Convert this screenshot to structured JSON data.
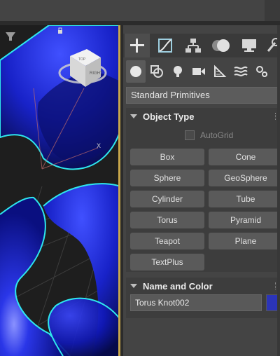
{
  "panel": {
    "dropdown_value": "Standard Primitives",
    "object_type": {
      "title": "Object Type",
      "autogrid_label": "AutoGrid",
      "buttons": [
        "Box",
        "Cone",
        "Sphere",
        "GeoSphere",
        "Cylinder",
        "Tube",
        "Torus",
        "Pyramid",
        "Teapot",
        "Plane",
        "TextPlus"
      ]
    },
    "name_and_color": {
      "title": "Name and Color",
      "object_name": "Torus Knot002",
      "color": "#2b34b8"
    },
    "tabs": [
      "create-icon",
      "modify-icon",
      "hierarchy-icon",
      "motion-icon",
      "display-icon",
      "utilities-icon"
    ],
    "subtabs": [
      "geometry-icon",
      "shapes-icon",
      "lights-icon",
      "cameras-icon",
      "helpers-icon",
      "spacewarps-icon",
      "systems-icon"
    ]
  },
  "viewport": {
    "object_color": "#1a21c9",
    "selection_color": "#2ee7ee"
  }
}
